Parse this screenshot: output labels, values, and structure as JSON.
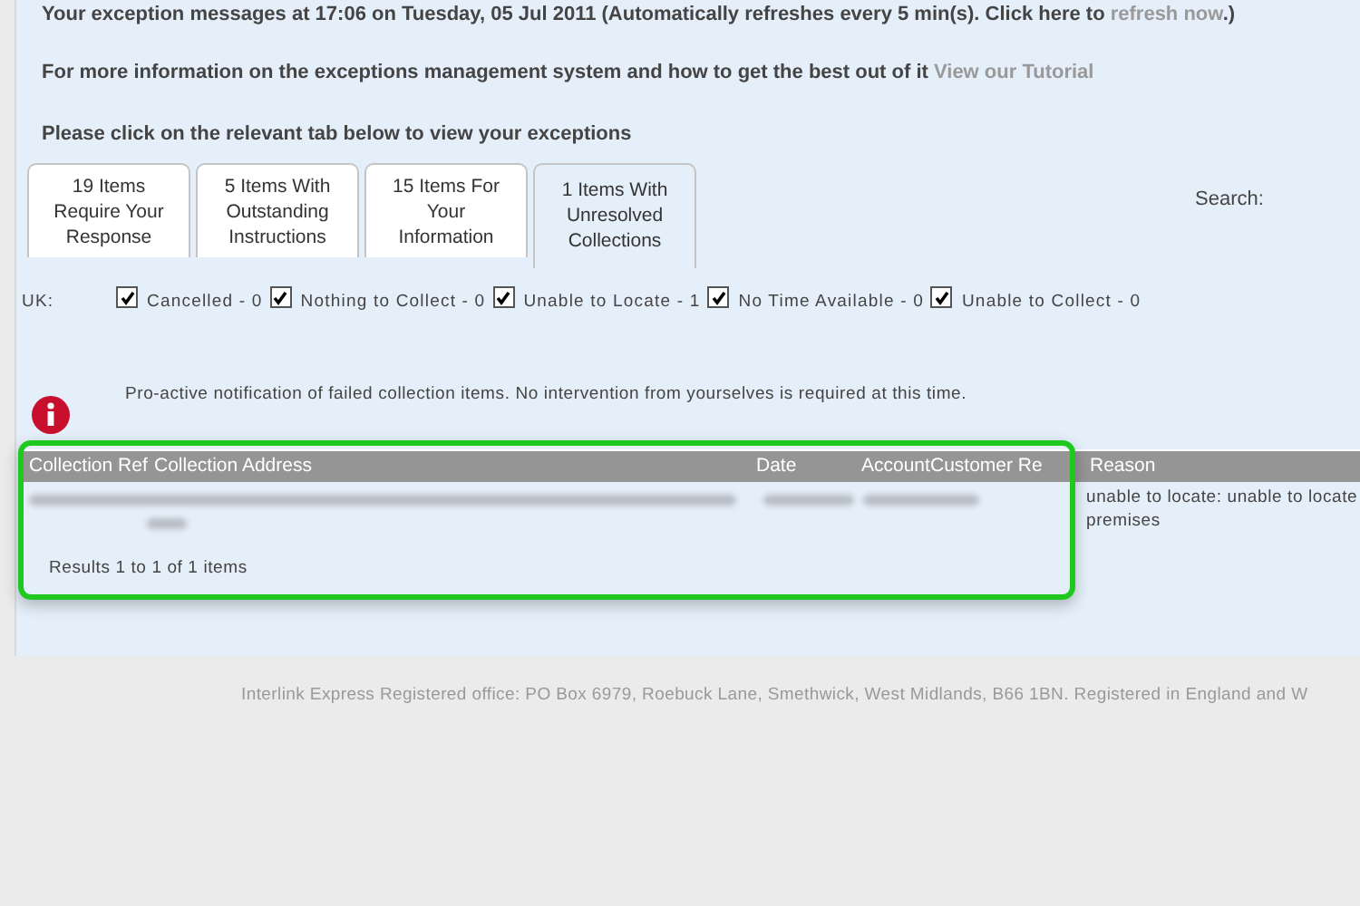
{
  "header": {
    "status_text": "Your exception messages at 17:06 on Tuesday, 05 Jul 2011 (Automatically refreshes every 5 min(s). Click here to",
    "refresh_link": "refresh now",
    "status_end": ".)",
    "info_text": "For more information on the exceptions management system and how to get the best out of it",
    "tutorial_link": "View our Tutorial",
    "instruction": "Please click on the relevant tab below to view your exceptions"
  },
  "tabs": [
    {
      "lines": [
        "19 Items",
        "Require Your",
        "Response"
      ],
      "selected": false
    },
    {
      "lines": [
        "5 Items With",
        "Outstanding",
        "Instructions"
      ],
      "selected": false
    },
    {
      "lines": [
        "15 Items For",
        "Your",
        "Information"
      ],
      "selected": false
    },
    {
      "lines": [
        "1 Items With",
        "Unresolved",
        "Collections"
      ],
      "selected": true
    }
  ],
  "search_label": "Search:",
  "filters": {
    "region": "UK:",
    "items": [
      {
        "label": "Cancelled - 0",
        "checked": true
      },
      {
        "label": "Nothing to Collect - 0",
        "checked": true
      },
      {
        "label": "Unable to Locate - 1",
        "checked": true
      },
      {
        "label": "No Time Available - 0",
        "checked": true
      },
      {
        "label": "Unable to Collect - 0",
        "checked": true
      }
    ]
  },
  "notification": "Pro-active notification of failed collection items. No intervention from yourselves is required at this time.",
  "table": {
    "columns": [
      "Collection Ref",
      "Collection Address",
      "Date",
      "Account",
      "Customer Re",
      "Reason"
    ],
    "rows": [
      {
        "reason": "unable to locate: unable to locate premises"
      }
    ],
    "results": "Results 1 to 1 of 1 items"
  },
  "footer": "Interlink Express Registered office: PO Box 6979, Roebuck Lane, Smethwick, West Midlands, B66 1BN. Registered in England and W"
}
